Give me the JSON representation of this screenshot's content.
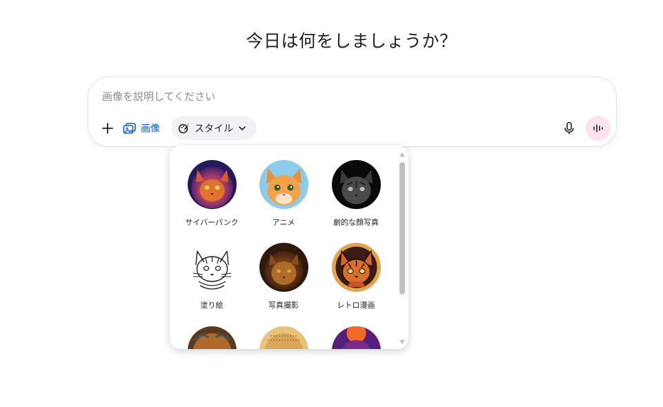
{
  "heading": "今日は何をしましょうか？",
  "composer": {
    "placeholder": "画像を説明してください",
    "image_label": "画像",
    "style_label": "スタイル"
  },
  "styles": [
    {
      "label": "サイバーパンク"
    },
    {
      "label": "アニメ"
    },
    {
      "label": "劇的な顔写真"
    },
    {
      "label": "塗り絵"
    },
    {
      "label": "写真撮影"
    },
    {
      "label": "レトロ漫画"
    },
    {
      "label": ""
    },
    {
      "label": ""
    },
    {
      "label": ""
    }
  ],
  "colors": {
    "accent": "#0b57d0",
    "voice_bg": "#fde3ee",
    "style_chip_bg": "#f0f2f5"
  }
}
